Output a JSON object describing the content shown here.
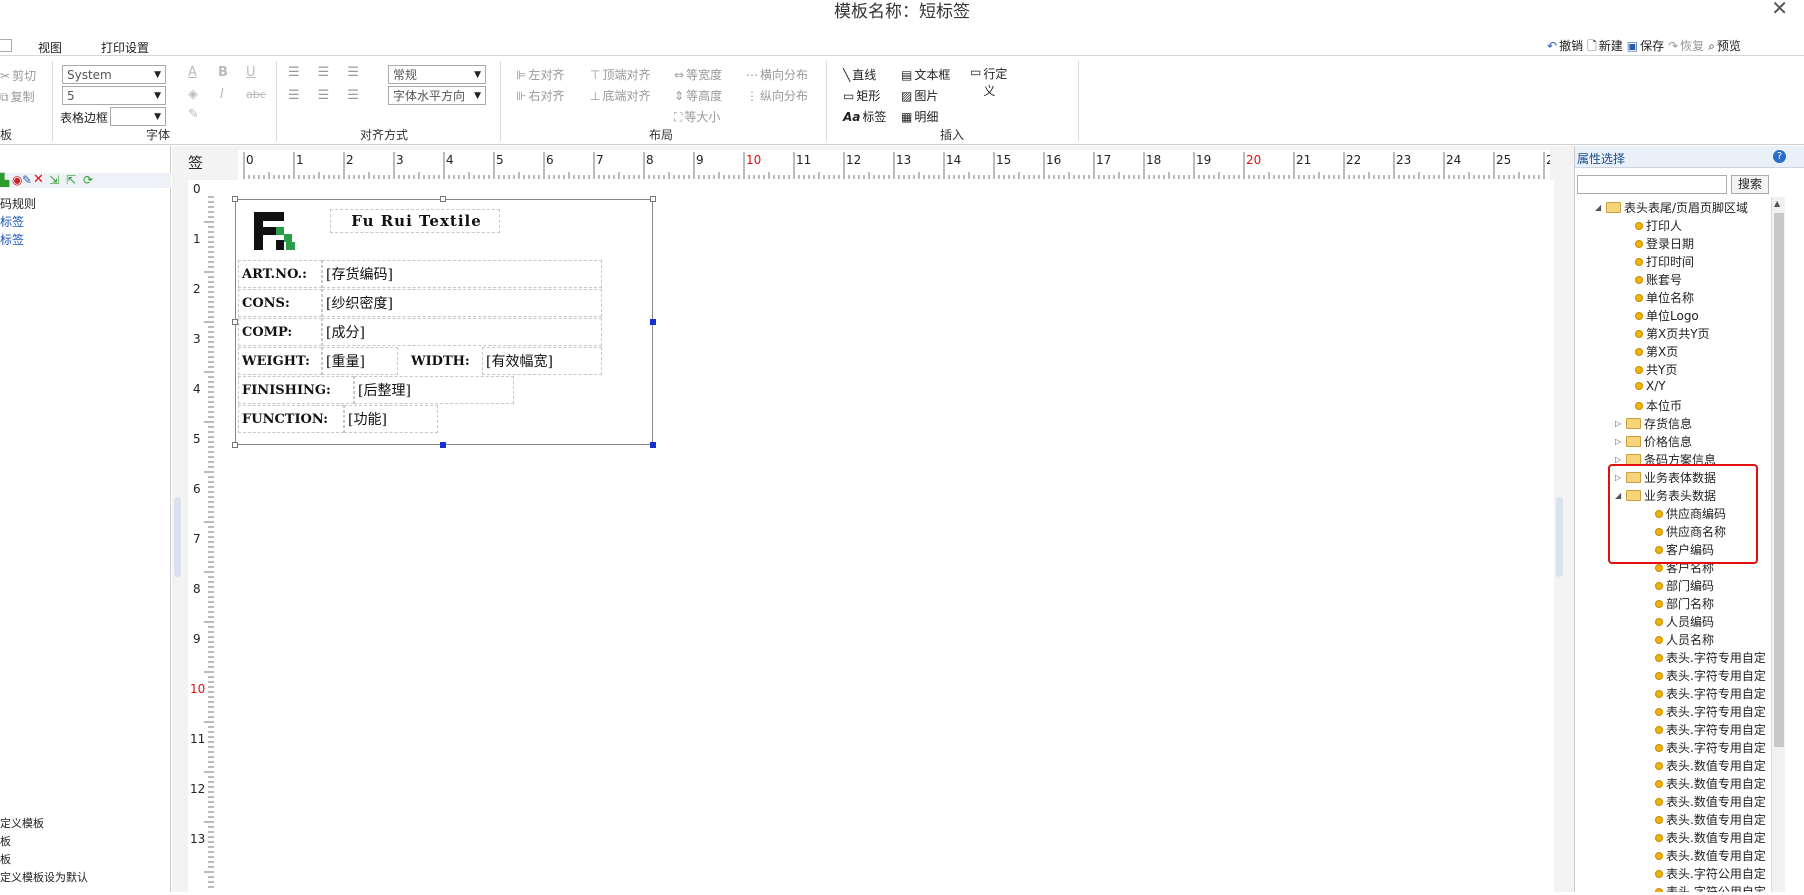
{
  "window": {
    "title": "模板名称：短标签"
  },
  "menubar": {
    "items": [
      "视图",
      "打印设置"
    ],
    "toolbar": [
      {
        "label": "撤销",
        "enabled": true
      },
      {
        "label": "新建",
        "enabled": true
      },
      {
        "label": "保存",
        "enabled": true
      },
      {
        "label": "恢复",
        "enabled": false
      },
      {
        "label": "预览",
        "enabled": true
      }
    ]
  },
  "ribbon": {
    "clipboard": {
      "cut": "剪切",
      "copy": "复制",
      "label": "板"
    },
    "font": {
      "family": "System",
      "size": "5",
      "border_label": "表格边框",
      "label": "字体"
    },
    "align": {
      "style": "常规",
      "halign": "字体水平方向",
      "label": "对齐方式"
    },
    "layout": {
      "label": "布局",
      "left": "左对齐",
      "right": "右对齐",
      "top": "顶端对齐",
      "bottom": "底端对齐",
      "same_width": "等宽度",
      "same_height": "等高度",
      "same_size": "等大小",
      "hdist": "横向分布",
      "vdist": "纵向分布"
    },
    "insert": {
      "label": "插入",
      "line": "直线",
      "textbox": "文本框",
      "rowdef": "行定义",
      "rect": "矩形",
      "image": "图片",
      "label_item": "标签",
      "detail": "明细"
    }
  },
  "left_panel": {
    "tab": "签",
    "items": [
      "码规则",
      "标签",
      "标签"
    ],
    "bottom_items": [
      "定义模板",
      "板",
      "板",
      "定义模板设为默认"
    ]
  },
  "ruler": {
    "top": [
      "0",
      "1",
      "2",
      "3",
      "4",
      "5",
      "6",
      "7",
      "8",
      "9",
      "10",
      "11",
      "12",
      "13",
      "14",
      "15",
      "16",
      "17",
      "18",
      "19",
      "20",
      "21",
      "22",
      "23",
      "24",
      "25",
      "2"
    ],
    "left": [
      "0",
      "1",
      "2",
      "3",
      "4",
      "5",
      "6",
      "7",
      "8",
      "9",
      "10",
      "11",
      "12",
      "13"
    ]
  },
  "label": {
    "title": "Fu Rui Textile",
    "rows": [
      {
        "key": "ART.NO.:",
        "value": "[存货编码]"
      },
      {
        "key": "CONS:",
        "value": "[纱织密度]"
      },
      {
        "key": "COMP:",
        "value": "[成分]"
      },
      {
        "key": "WEIGHT:",
        "value": "[重量]",
        "key2": "WIDTH:",
        "value2": "[有效幅宽]"
      },
      {
        "key": "FINISHING:",
        "value": "[后整理]"
      },
      {
        "key": "FUNCTION:",
        "value": "[功能]"
      }
    ]
  },
  "right_panel": {
    "title": "属性选择",
    "search_button": "搜索",
    "search_placeholder": "",
    "tree": {
      "root": "表头表尾/页眉页脚区域",
      "root_children": [
        "打印人",
        "登录日期",
        "打印时间",
        "账套号",
        "单位名称",
        "单位Logo",
        "第X页共Y页",
        "第X页",
        "共Y页",
        "X/Y",
        "本位币"
      ],
      "folders": [
        "存货信息",
        "价格信息",
        "条码方案信息",
        "业务表体数据",
        "业务表头数据"
      ],
      "header_children": [
        "供应商编码",
        "供应商名称",
        "客户编码",
        "客户名称",
        "部门编码",
        "部门名称",
        "人员编码",
        "人员名称",
        "表头.字符专用自定",
        "表头.字符专用自定",
        "表头.字符专用自定",
        "表头.字符专用自定",
        "表头.字符专用自定",
        "表头.字符专用自定",
        "表头.数值专用自定",
        "表头.数值专用自定",
        "表头.数值专用自定",
        "表头.数值专用自定",
        "表头.数值专用自定",
        "表头.数值专用自定",
        "表头.字符公用自定",
        "表头.字符公用自定"
      ]
    }
  },
  "colors": {
    "highlight": "#e01010",
    "ruler_red": "#e01010",
    "accent": "#1a56b8"
  }
}
